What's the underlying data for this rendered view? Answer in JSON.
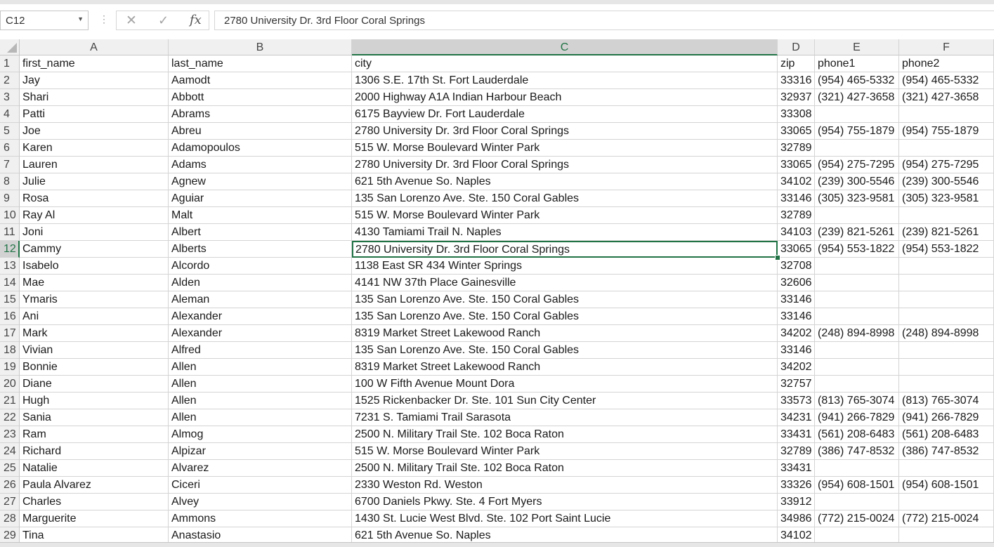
{
  "formula_bar": {
    "name_box": "C12",
    "formula_value": "2780 University Dr. 3rd Floor Coral Springs",
    "cancel_glyph": "✕",
    "enter_glyph": "✓",
    "fx_glyph": "fx"
  },
  "columns": [
    "A",
    "B",
    "C",
    "D",
    "E",
    "F"
  ],
  "active_cell": {
    "row": 12,
    "column": "C"
  },
  "header_row": [
    "first_name",
    "last_name",
    "city",
    "zip",
    "phone1",
    "phone2"
  ],
  "rows": [
    [
      "Jay",
      "Aamodt",
      "1306 S.E. 17th St. Fort Lauderdale",
      "33316",
      "(954) 465-5332",
      "(954) 465-5332"
    ],
    [
      "Shari",
      "Abbott",
      "2000 Highway A1A Indian Harbour Beach",
      "32937",
      "(321) 427-3658",
      "(321) 427-3658"
    ],
    [
      "Patti",
      "Abrams",
      "6175 Bayview Dr. Fort Lauderdale",
      "33308",
      "",
      ""
    ],
    [
      "Joe",
      "Abreu",
      "2780 University Dr. 3rd Floor Coral Springs",
      "33065",
      "(954) 755-1879",
      "(954) 755-1879"
    ],
    [
      "Karen",
      "Adamopoulos",
      "515 W. Morse Boulevard Winter Park",
      "32789",
      "",
      ""
    ],
    [
      "Lauren",
      "Adams",
      "2780 University Dr. 3rd Floor Coral Springs",
      "33065",
      "(954) 275-7295",
      "(954) 275-7295"
    ],
    [
      "Julie",
      "Agnew",
      "621 5th Avenue So. Naples",
      "34102",
      "(239) 300-5546",
      "(239) 300-5546"
    ],
    [
      "Rosa",
      "Aguiar",
      "135 San Lorenzo Ave. Ste. 150 Coral Gables",
      "33146",
      "(305) 323-9581",
      "(305) 323-9581"
    ],
    [
      "Ray Al",
      "Malt",
      "515 W. Morse Boulevard Winter Park",
      "32789",
      "",
      ""
    ],
    [
      "Joni",
      "Albert",
      "4130 Tamiami Trail N. Naples",
      "34103",
      "(239) 821-5261",
      "(239) 821-5261"
    ],
    [
      "Cammy",
      "Alberts",
      "2780 University Dr. 3rd Floor Coral Springs",
      "33065",
      "(954) 553-1822",
      "(954) 553-1822"
    ],
    [
      "Isabelo",
      "Alcordo",
      "1138 East SR 434 Winter Springs",
      "32708",
      "",
      ""
    ],
    [
      "Mae",
      "Alden",
      "4141 NW 37th Place Gainesville",
      "32606",
      "",
      ""
    ],
    [
      "Ymaris",
      "Aleman",
      "135 San Lorenzo Ave. Ste. 150 Coral Gables",
      "33146",
      "",
      ""
    ],
    [
      "Ani",
      "Alexander",
      "135 San Lorenzo Ave. Ste. 150 Coral Gables",
      "33146",
      "",
      ""
    ],
    [
      "Mark",
      "Alexander",
      "8319 Market Street Lakewood Ranch",
      "34202",
      "(248) 894-8998",
      "(248) 894-8998"
    ],
    [
      "Vivian",
      "Alfred",
      "135 San Lorenzo Ave. Ste. 150 Coral Gables",
      "33146",
      "",
      ""
    ],
    [
      "Bonnie",
      "Allen",
      "8319 Market Street Lakewood Ranch",
      "34202",
      "",
      ""
    ],
    [
      "Diane",
      "Allen",
      "100 W Fifth Avenue Mount Dora",
      "32757",
      "",
      ""
    ],
    [
      "Hugh",
      "Allen",
      "1525 Rickenbacker Dr. Ste. 101 Sun City Center",
      "33573",
      "(813) 765-3074",
      "(813) 765-3074"
    ],
    [
      "Sania",
      "Allen",
      "7231 S. Tamiami Trail Sarasota",
      "34231",
      "(941) 266-7829",
      "(941) 266-7829"
    ],
    [
      "Ram",
      "Almog",
      "2500 N. Military Trail Ste. 102 Boca Raton",
      "33431",
      "(561) 208-6483",
      "(561) 208-6483"
    ],
    [
      "Richard",
      "Alpizar",
      "515 W. Morse Boulevard Winter Park",
      "32789",
      "(386) 747-8532",
      "(386) 747-8532"
    ],
    [
      "Natalie",
      "Alvarez",
      "2500 N. Military Trail Ste. 102 Boca Raton",
      "33431",
      "",
      ""
    ],
    [
      "Paula Alvarez",
      "Ciceri",
      "2330 Weston Rd. Weston",
      "33326",
      "(954) 608-1501",
      "(954) 608-1501"
    ],
    [
      "Charles",
      "Alvey",
      "6700 Daniels Pkwy. Ste. 4 Fort Myers",
      "33912",
      "",
      ""
    ],
    [
      "Marguerite",
      "Ammons",
      "1430 St. Lucie West Blvd. Ste. 102 Port Saint Lucie",
      "34986",
      "(772) 215-0024",
      "(772) 215-0024"
    ],
    [
      "Tina",
      "Anastasio",
      "621 5th Avenue So. Naples",
      "34102",
      "",
      ""
    ]
  ],
  "colors": {
    "accent": "#217346",
    "header_bg": "#f0f0f0",
    "gridline": "#d4d4d4"
  }
}
